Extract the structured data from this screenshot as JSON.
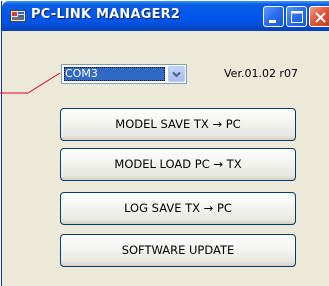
{
  "window": {
    "title": "PC-LINK MANAGER2",
    "icon": "app-icon"
  },
  "titlebar_buttons": {
    "minimize_icon": "minimize-icon",
    "maximize_icon": "maximize-icon",
    "close_icon": "close-icon"
  },
  "port_select": {
    "value": "COM3",
    "arrow_icon": "chevron-down-icon"
  },
  "version_label": "Ver.01.02 r07",
  "buttons": [
    {
      "label": "MODEL SAVE TX → PC"
    },
    {
      "label": "MODEL LOAD PC → TX"
    },
    {
      "label": "LOG SAVE TX → PC"
    },
    {
      "label": "SOFTWARE UPDATE"
    }
  ],
  "colors": {
    "titlebar": "#0054e3",
    "window_bg": "#ece9d8",
    "selection": "#316ac5",
    "callout_line": "#e0002a"
  }
}
